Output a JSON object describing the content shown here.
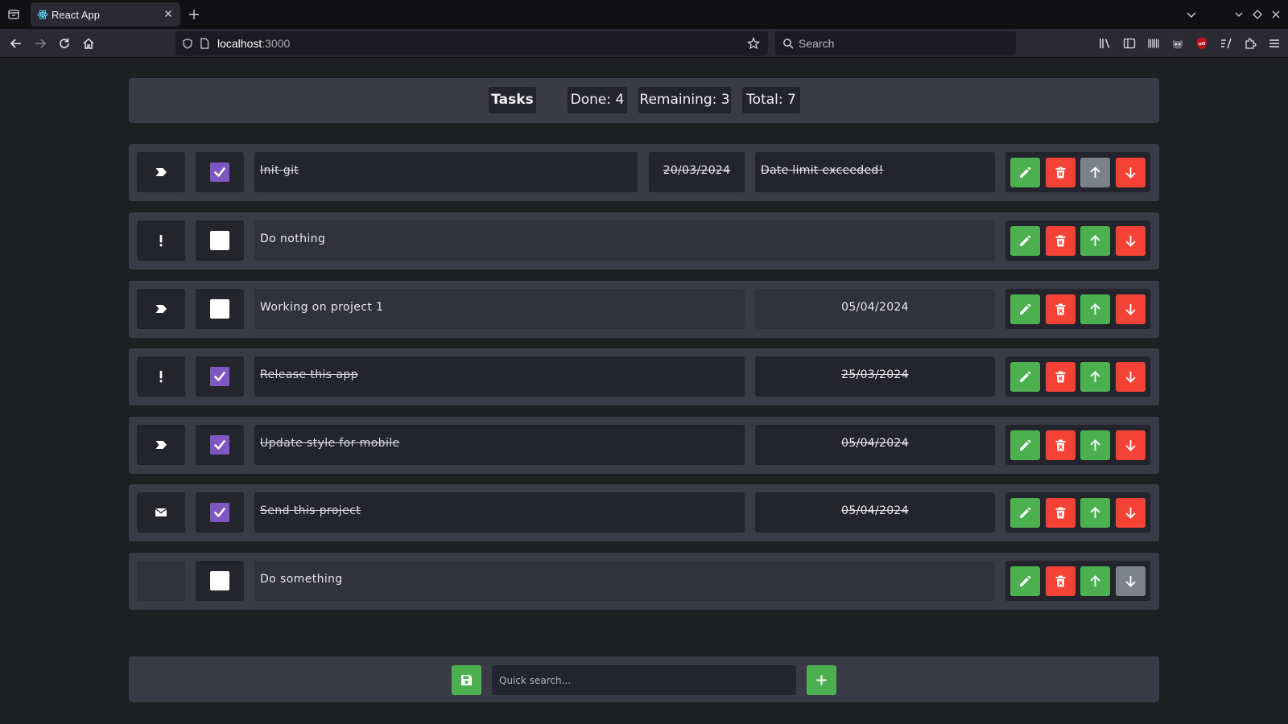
{
  "browser": {
    "tab_title": "React App",
    "url_host": "localhost",
    "url_port": ":3000",
    "search_placeholder": "Search"
  },
  "header": {
    "title": "Tasks",
    "done": "Done: 4",
    "remaining": "Remaining: 3",
    "total": "Total: 7"
  },
  "tasks": [
    {
      "priority_icon": "tag-icon",
      "done": true,
      "text": "Init git",
      "date": "20/03/2024",
      "note": "Date limit exceeded!",
      "up_enabled": false,
      "down_enabled": true
    },
    {
      "priority_icon": "exclamation-icon",
      "done": false,
      "text": "Do nothing",
      "date": "",
      "note": "",
      "up_enabled": true,
      "down_enabled": true
    },
    {
      "priority_icon": "tag-icon",
      "done": false,
      "text": "Working on project 1",
      "date": "05/04/2024",
      "note": "",
      "up_enabled": true,
      "down_enabled": true
    },
    {
      "priority_icon": "exclamation-icon",
      "done": true,
      "text": "Release this app",
      "date": "25/03/2024",
      "note": "",
      "up_enabled": true,
      "down_enabled": true
    },
    {
      "priority_icon": "tag-icon",
      "done": true,
      "text": "Update style for mobile",
      "date": "05/04/2024",
      "note": "",
      "up_enabled": true,
      "down_enabled": true
    },
    {
      "priority_icon": "envelope-icon",
      "done": true,
      "text": "Send this project",
      "date": "05/04/2024",
      "note": "",
      "up_enabled": true,
      "down_enabled": true
    },
    {
      "priority_icon": "",
      "done": false,
      "text": "Do something",
      "date": "",
      "note": "",
      "up_enabled": true,
      "down_enabled": false
    }
  ],
  "footer": {
    "search_placeholder": "Quick search..."
  },
  "colors": {
    "page_bg": "#1e1f23",
    "panel_bg": "#3a3b47",
    "cell_bg": "#23242c",
    "cell_light_bg": "#31323e",
    "checkbox_checked": "#7e57c2",
    "green": "#4caf50",
    "red": "#f44336",
    "disabled": "#7c818c"
  }
}
